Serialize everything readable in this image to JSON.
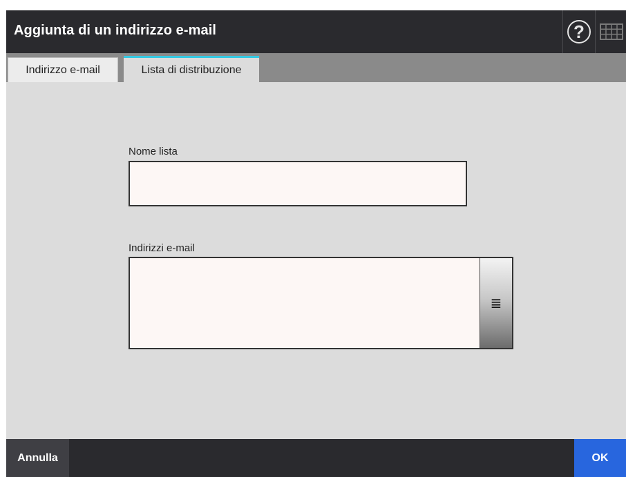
{
  "window": {
    "title": "Aggiunta di un indirizzo e-mail",
    "help_icon": "help-icon",
    "keyboard_icon": "keyboard-icon"
  },
  "tabs": [
    {
      "label": "Indirizzo e-mail",
      "active": false
    },
    {
      "label": "Lista di distribuzione",
      "active": true
    }
  ],
  "form": {
    "list_name_label": "Nome lista",
    "list_name_value": "",
    "emails_label": "Indirizzi e-mail",
    "emails_value": "",
    "emails_button_icon": "list-select-icon"
  },
  "footer": {
    "cancel_label": "Annulla",
    "ok_label": "OK"
  },
  "colors": {
    "titlebar": "#2a2a2e",
    "tab_accent": "#35c9e3",
    "ok_button": "#2866de",
    "background": "#dcdcdc"
  }
}
